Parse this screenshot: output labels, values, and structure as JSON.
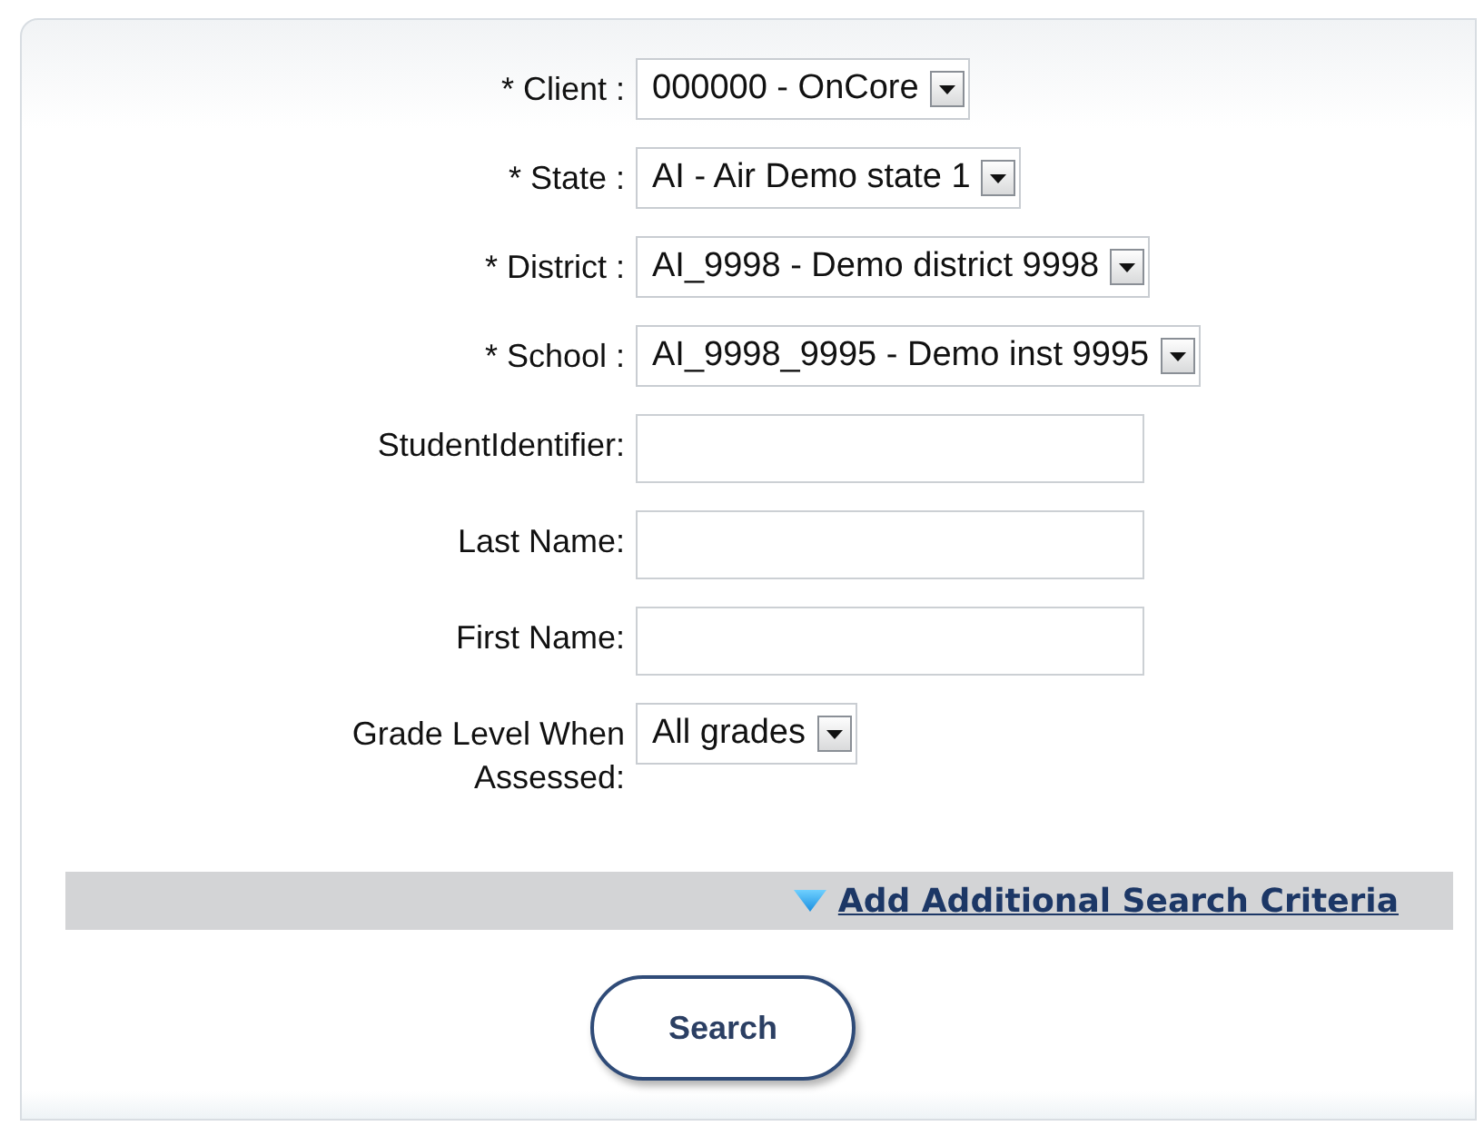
{
  "fields": [
    {
      "kind": "select",
      "label": "* Client :",
      "value": "000000 - OnCore"
    },
    {
      "kind": "select",
      "label": "* State :",
      "value": "AI - Air Demo state 1"
    },
    {
      "kind": "select",
      "label": "* District :",
      "value": "AI_9998 - Demo district 9998"
    },
    {
      "kind": "select",
      "label": "* School :",
      "value": "AI_9998_9995 - Demo inst 9995"
    },
    {
      "kind": "text",
      "label": "StudentIdentifier:"
    },
    {
      "kind": "text",
      "label": "Last Name:"
    },
    {
      "kind": "text",
      "label": "First Name:"
    },
    {
      "kind": "select",
      "label": "Grade Level When Assessed:",
      "value": "All grades"
    }
  ],
  "more_link": {
    "label": "Add Additional Search Criteria",
    "expanded": false
  },
  "search_button": "Search"
}
